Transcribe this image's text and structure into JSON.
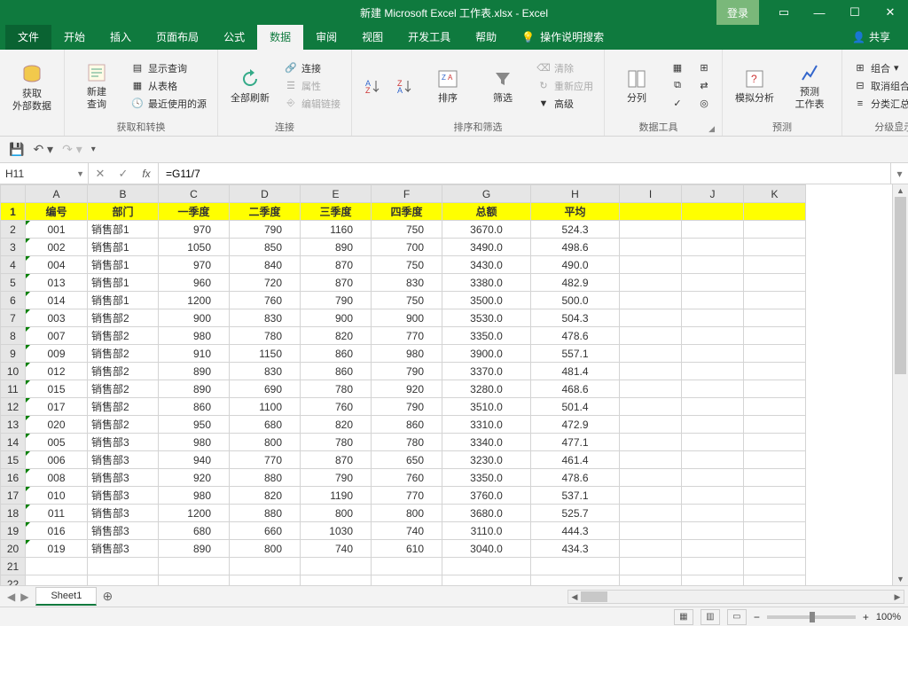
{
  "title": "新建 Microsoft Excel 工作表.xlsx - Excel",
  "titlebar": {
    "login": "登录"
  },
  "tabs": {
    "file": "文件",
    "home": "开始",
    "insert": "插入",
    "layout": "页面布局",
    "formulas": "公式",
    "data": "数据",
    "review": "审阅",
    "view": "视图",
    "dev": "开发工具",
    "help": "帮助",
    "tell": "操作说明搜索",
    "share": "共享"
  },
  "ribbon": {
    "g1": {
      "label": "获取和转换",
      "ext": "获取\n外部数据",
      "newq": "新建\n查询",
      "show": "显示查询",
      "table": "从表格",
      "recent": "最近使用的源"
    },
    "g2": {
      "label": "连接",
      "refresh": "全部刷新",
      "conn": "连接",
      "prop": "属性",
      "edit": "编辑链接"
    },
    "g3": {
      "label": "排序和筛选",
      "sort": "排序",
      "filter": "筛选",
      "clear": "清除",
      "reapply": "重新应用",
      "adv": "高级"
    },
    "g4": {
      "label": "数据工具",
      "split": "分列"
    },
    "g5": {
      "label": "预测",
      "whatif": "模拟分析",
      "forecast": "预测\n工作表"
    },
    "g6": {
      "label": "分级显示",
      "group": "组合",
      "ungroup": "取消组合",
      "subtotal": "分类汇总"
    }
  },
  "namebox": "H11",
  "formula": "=G11/7",
  "columns": [
    "A",
    "B",
    "C",
    "D",
    "E",
    "F",
    "G",
    "H",
    "I",
    "J",
    "K"
  ],
  "headers": [
    "编号",
    "部门",
    "一季度",
    "二季度",
    "三季度",
    "四季度",
    "总额",
    "平均"
  ],
  "rows": [
    [
      "001",
      "销售部1",
      "970",
      "790",
      "1160",
      "750",
      "3670.0",
      "524.3"
    ],
    [
      "002",
      "销售部1",
      "1050",
      "850",
      "890",
      "700",
      "3490.0",
      "498.6"
    ],
    [
      "004",
      "销售部1",
      "970",
      "840",
      "870",
      "750",
      "3430.0",
      "490.0"
    ],
    [
      "013",
      "销售部1",
      "960",
      "720",
      "870",
      "830",
      "3380.0",
      "482.9"
    ],
    [
      "014",
      "销售部1",
      "1200",
      "760",
      "790",
      "750",
      "3500.0",
      "500.0"
    ],
    [
      "003",
      "销售部2",
      "900",
      "830",
      "900",
      "900",
      "3530.0",
      "504.3"
    ],
    [
      "007",
      "销售部2",
      "980",
      "780",
      "820",
      "770",
      "3350.0",
      "478.6"
    ],
    [
      "009",
      "销售部2",
      "910",
      "1150",
      "860",
      "980",
      "3900.0",
      "557.1"
    ],
    [
      "012",
      "销售部2",
      "890",
      "830",
      "860",
      "790",
      "3370.0",
      "481.4"
    ],
    [
      "015",
      "销售部2",
      "890",
      "690",
      "780",
      "920",
      "3280.0",
      "468.6"
    ],
    [
      "017",
      "销售部2",
      "860",
      "1100",
      "760",
      "790",
      "3510.0",
      "501.4"
    ],
    [
      "020",
      "销售部2",
      "950",
      "680",
      "820",
      "860",
      "3310.0",
      "472.9"
    ],
    [
      "005",
      "销售部3",
      "980",
      "800",
      "780",
      "780",
      "3340.0",
      "477.1"
    ],
    [
      "006",
      "销售部3",
      "940",
      "770",
      "870",
      "650",
      "3230.0",
      "461.4"
    ],
    [
      "008",
      "销售部3",
      "920",
      "880",
      "790",
      "760",
      "3350.0",
      "478.6"
    ],
    [
      "010",
      "销售部3",
      "980",
      "820",
      "1190",
      "770",
      "3760.0",
      "537.1"
    ],
    [
      "011",
      "销售部3",
      "1200",
      "880",
      "800",
      "800",
      "3680.0",
      "525.7"
    ],
    [
      "016",
      "销售部3",
      "680",
      "660",
      "1030",
      "740",
      "3110.0",
      "444.3"
    ],
    [
      "019",
      "销售部3",
      "890",
      "800",
      "740",
      "610",
      "3040.0",
      "434.3"
    ]
  ],
  "sheet": "Sheet1",
  "zoom": "100%"
}
